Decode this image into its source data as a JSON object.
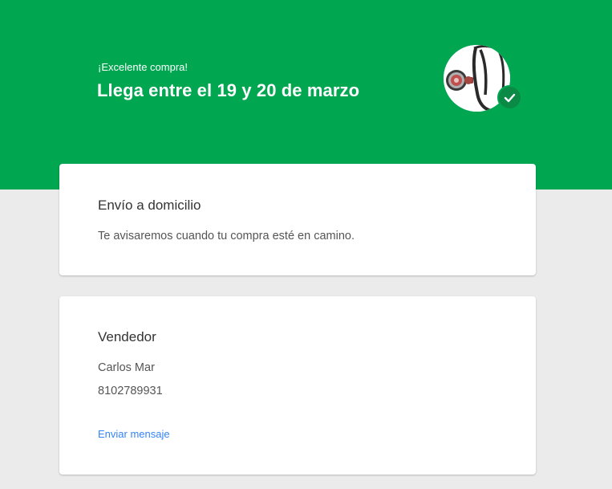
{
  "header": {
    "subtitle": "¡Excelente compra!",
    "title": "Llega entre el 19 y 20 de marzo",
    "product_icon": "stethoscope-image",
    "status_icon": "checkmark-icon"
  },
  "shipping": {
    "title": "Envío a domicilio",
    "message": "Te avisaremos cuando tu compra esté en camino."
  },
  "seller": {
    "title": "Vendedor",
    "name": "Carlos Mar",
    "phone": "8102789931",
    "message_link": "Enviar mensaje"
  },
  "colors": {
    "brand_green": "#00a650",
    "link_blue": "#3483fa",
    "background": "#ebebeb"
  }
}
